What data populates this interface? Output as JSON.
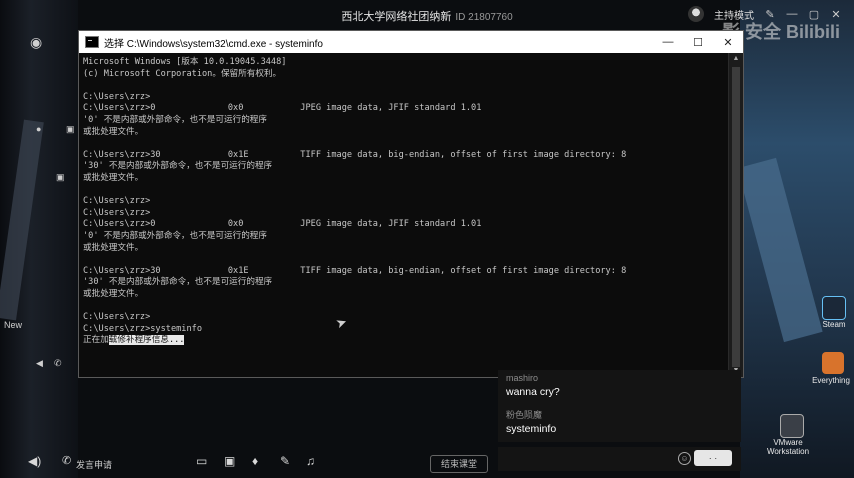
{
  "live": {
    "title": "西北大学网络社团纳新",
    "id": "ID 21807760",
    "presenter_mode": "主持模式"
  },
  "cmd": {
    "title": "选择 C:\\Windows\\system32\\cmd.exe - systeminfo",
    "lines": [
      "Microsoft Windows [版本 10.0.19045.3448]",
      "(c) Microsoft Corporation。保留所有权利。",
      "",
      "C:\\Users\\zrz>",
      "C:\\Users\\zrz>0              0x0           JPEG image data, JFIF standard 1.01",
      "'0' 不是内部或外部命令，也不是可运行的程序",
      "或批处理文件。",
      "",
      "C:\\Users\\zrz>30             0x1E          TIFF image data, big-endian, offset of first image directory: 8",
      "'30' 不是内部或外部命令，也不是可运行的程序",
      "或批处理文件。",
      "",
      "C:\\Users\\zrz>",
      "C:\\Users\\zrz>",
      "C:\\Users\\zrz>0              0x0           JPEG image data, JFIF standard 1.01",
      "'0' 不是内部或外部命令，也不是可运行的程序",
      "或批处理文件。",
      "",
      "C:\\Users\\zrz>30             0x1E          TIFF image data, big-endian, offset of first image directory: 8",
      "'30' 不是内部或外部命令，也不是可运行的程序",
      "或批处理文件。",
      "",
      "C:\\Users\\zrz>",
      "C:\\Users\\zrz>systeminfo"
    ],
    "loading_prefix": "正在加",
    "loading_selected": "载修补程序信息..."
  },
  "chat": {
    "messages": [
      {
        "name": "mashiro",
        "text": "wanna cry?"
      },
      {
        "name": "粉色陨魔",
        "text": "systeminfo"
      }
    ],
    "send_label": "· ·"
  },
  "bottom": {
    "mic_label": "发言申请",
    "class_button": "结束课堂"
  },
  "desktop": {
    "watermark": "影 安全 Bilibili",
    "icons": [
      "Steam",
      "Everything",
      "VMware Workstation"
    ],
    "left_label": "New"
  },
  "colors": {
    "cmd_bg": "#0c0c0c",
    "cmd_text": "#c7c7c7",
    "chat_bg": "#141414"
  }
}
